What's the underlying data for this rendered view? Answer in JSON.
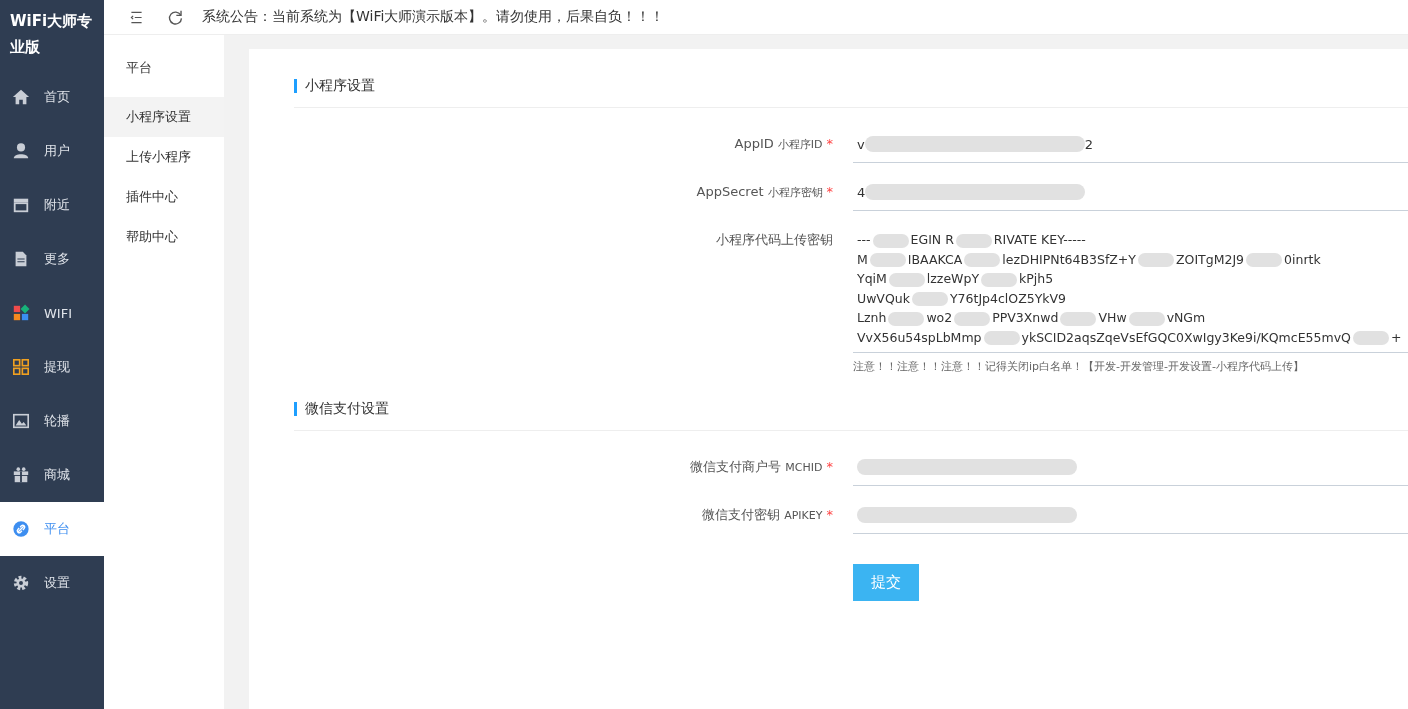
{
  "brand": "WiFi大师专业版",
  "menu": [
    {
      "label": "首页",
      "selected": false
    },
    {
      "label": "用户",
      "selected": false
    },
    {
      "label": "附近",
      "selected": false
    },
    {
      "label": "更多",
      "selected": false
    },
    {
      "label": "WIFI",
      "selected": false
    },
    {
      "label": "提现",
      "selected": false
    },
    {
      "label": "轮播",
      "selected": false
    },
    {
      "label": "商城",
      "selected": false
    },
    {
      "label": "平台",
      "selected": true
    },
    {
      "label": "设置",
      "selected": false
    }
  ],
  "notice": "系统公告：当前系统为【WiFi大师演示版本】。请勿使用，后果自负！！！",
  "subnav": {
    "title": "平台",
    "items": [
      {
        "label": "小程序设置",
        "selected": true
      },
      {
        "label": "上传小程序",
        "selected": false
      },
      {
        "label": "插件中心",
        "selected": false
      },
      {
        "label": "帮助中心",
        "selected": false
      }
    ]
  },
  "sections": [
    {
      "title": "小程序设置",
      "fields": [
        {
          "kind": "input",
          "label": "AppID",
          "sub": "小程序ID",
          "mark": "*",
          "prefix": "v",
          "suffix": "2"
        },
        {
          "kind": "input",
          "label": "AppSecret",
          "sub": "小程序密钥",
          "mark": "*",
          "prefix": "4"
        },
        {
          "kind": "textarea",
          "label": "小程序代码上传密钥",
          "lines": [
            [
              "---",
              "EGIN R",
              "RIVATE KEY-----"
            ],
            [
              "M",
              "IBAAKCA",
              "lezDHIPNt64B3SfZ+Y",
              "ZOITgM2J9",
              "0inrtk"
            ],
            [
              "YqiM",
              "lzzeWpY",
              "kPjh5"
            ],
            [
              "UwVQuk",
              "Y76tJp4clOZ5YkV9"
            ],
            [
              "Lznh",
              "wo2",
              "PPV3Xnwd",
              "VHw",
              "vNGm"
            ],
            [
              "VvX56u54spLbMmp",
              "ykSCID2aqsZqeVsEfGQC0XwIgy3Ke9i/KQmcE55mvQ",
              "+"
            ]
          ],
          "hint": "注意！！注意！！注意！！记得关闭ip白名单！【开发-开发管理-开发设置-小程序代码上传】"
        }
      ]
    },
    {
      "title": "微信支付设置",
      "fields": [
        {
          "kind": "input",
          "label": "微信支付商户号",
          "sub": "MCHID",
          "mark": "*"
        },
        {
          "kind": "input",
          "label": "微信支付密钥",
          "sub": "APIKEY",
          "mark": "*"
        }
      ]
    }
  ],
  "submit": "提交"
}
